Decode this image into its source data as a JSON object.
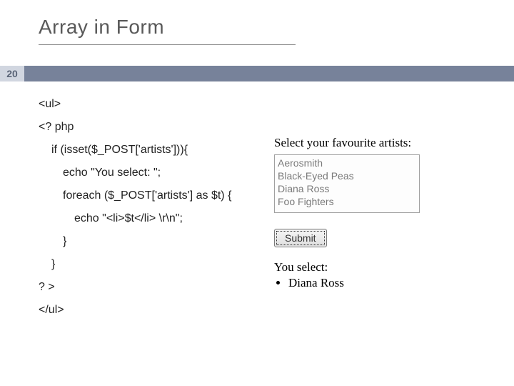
{
  "title": "Array in Form",
  "page_number": "20",
  "code": {
    "l1": "<ul>",
    "l2": "<? php",
    "l3": "if (isset($_POST['artists'])){",
    "l4": "echo \"You select: \";",
    "l5": "foreach ($_POST['artists'] as $t) {",
    "l6": "echo \"<li>$t</li> \\r\\n\";",
    "l7": "}",
    "l8": "}",
    "l9": "? >",
    "l10": "</ul>"
  },
  "demo": {
    "label": "Select your favourite artists:",
    "options": [
      "Aerosmith",
      "Black-Eyed Peas",
      "Diana Ross",
      "Foo Fighters"
    ],
    "submit_label": "Submit",
    "output_heading": "You select:",
    "output_items": [
      "Diana Ross"
    ]
  }
}
